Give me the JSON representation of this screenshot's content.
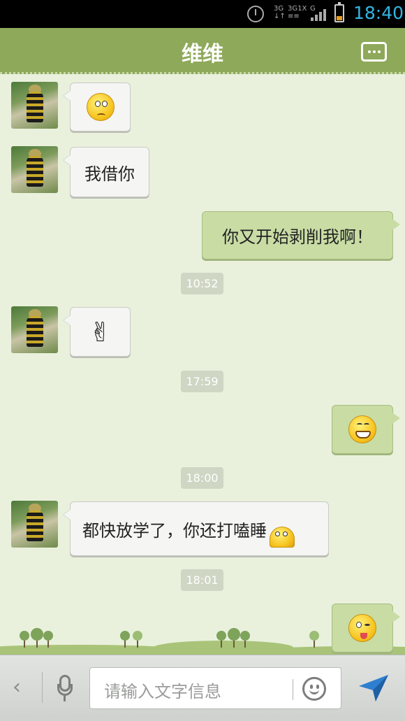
{
  "status_bar": {
    "time": "18:40",
    "network_labels": [
      "3G",
      "3G",
      "1X",
      "G"
    ],
    "icons": [
      "alarm-icon",
      "signal-icon",
      "battery-icon"
    ]
  },
  "header": {
    "title": "维维",
    "menu_icon": "more-options-icon"
  },
  "messages": [
    {
      "side": "in",
      "type": "emoji",
      "emoji": "confused-face"
    },
    {
      "side": "in",
      "type": "text",
      "text": "我借你"
    },
    {
      "side": "out",
      "type": "text",
      "text": "你又开始剥削我啊！"
    },
    {
      "type": "timestamp",
      "text": "10:52"
    },
    {
      "side": "in",
      "type": "emoji",
      "emoji": "victory-hand",
      "glyph": "✌"
    },
    {
      "type": "timestamp",
      "text": "17:59"
    },
    {
      "side": "out",
      "type": "emoji",
      "emoji": "grinning-face"
    },
    {
      "type": "timestamp",
      "text": "18:00"
    },
    {
      "side": "in",
      "type": "text",
      "text": "都快放学了，你还打嗑睡",
      "emoji": "sleepy-face"
    },
    {
      "type": "timestamp",
      "text": "18:01"
    },
    {
      "side": "out",
      "type": "emoji",
      "emoji": "wink-tongue-face"
    }
  ],
  "input_bar": {
    "back_glyph": "‹",
    "placeholder": "请输入文字信息",
    "icons": [
      "back-icon",
      "microphone-icon",
      "emoji-icon",
      "send-icon"
    ]
  },
  "colors": {
    "header": "#8ea95a",
    "chat_background": "#e9f1dd",
    "outgoing_bubble": "#c8dca4",
    "incoming_bubble": "#f5f5f3",
    "clock": "#33b5e5",
    "send": "#2e7fd0"
  }
}
